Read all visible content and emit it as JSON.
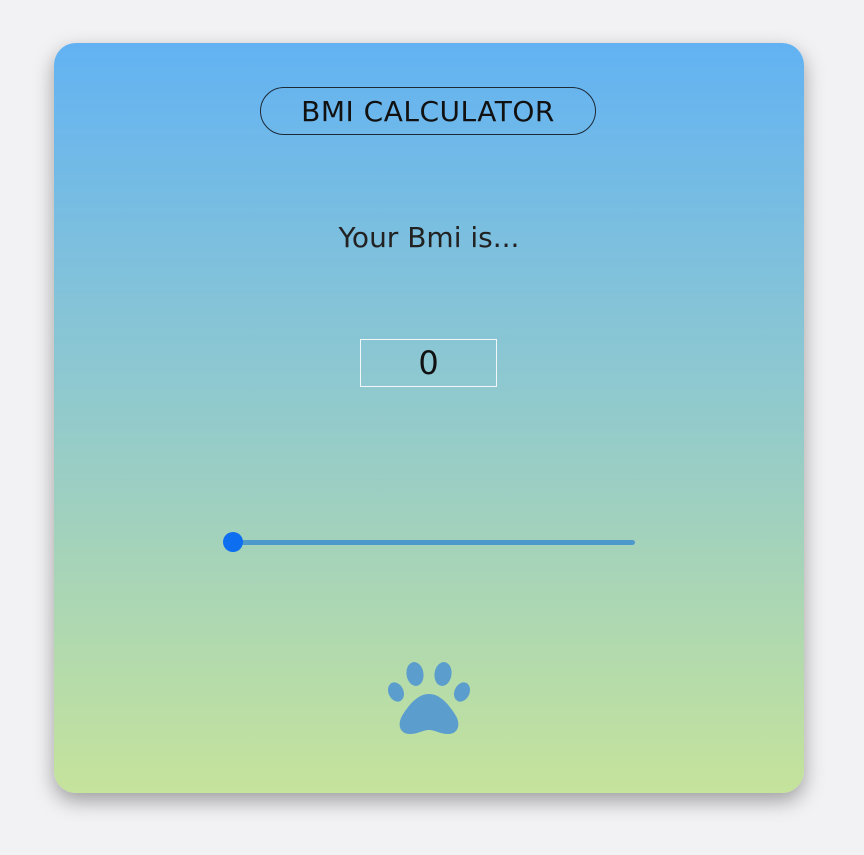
{
  "app": {
    "title": "BMI CALCULATOR",
    "subtitle": "Your Bmi is...",
    "result_value": "0"
  },
  "slider": {
    "value_fraction": 0.0,
    "track_color": "#4e99cc",
    "thumb_color": "#0d6ff0"
  },
  "icons": {
    "paw": "paw-icon"
  },
  "colors": {
    "gradient_top": "#62b2f3",
    "gradient_bottom": "#c5e39b",
    "paw": "#5b9ecd"
  }
}
